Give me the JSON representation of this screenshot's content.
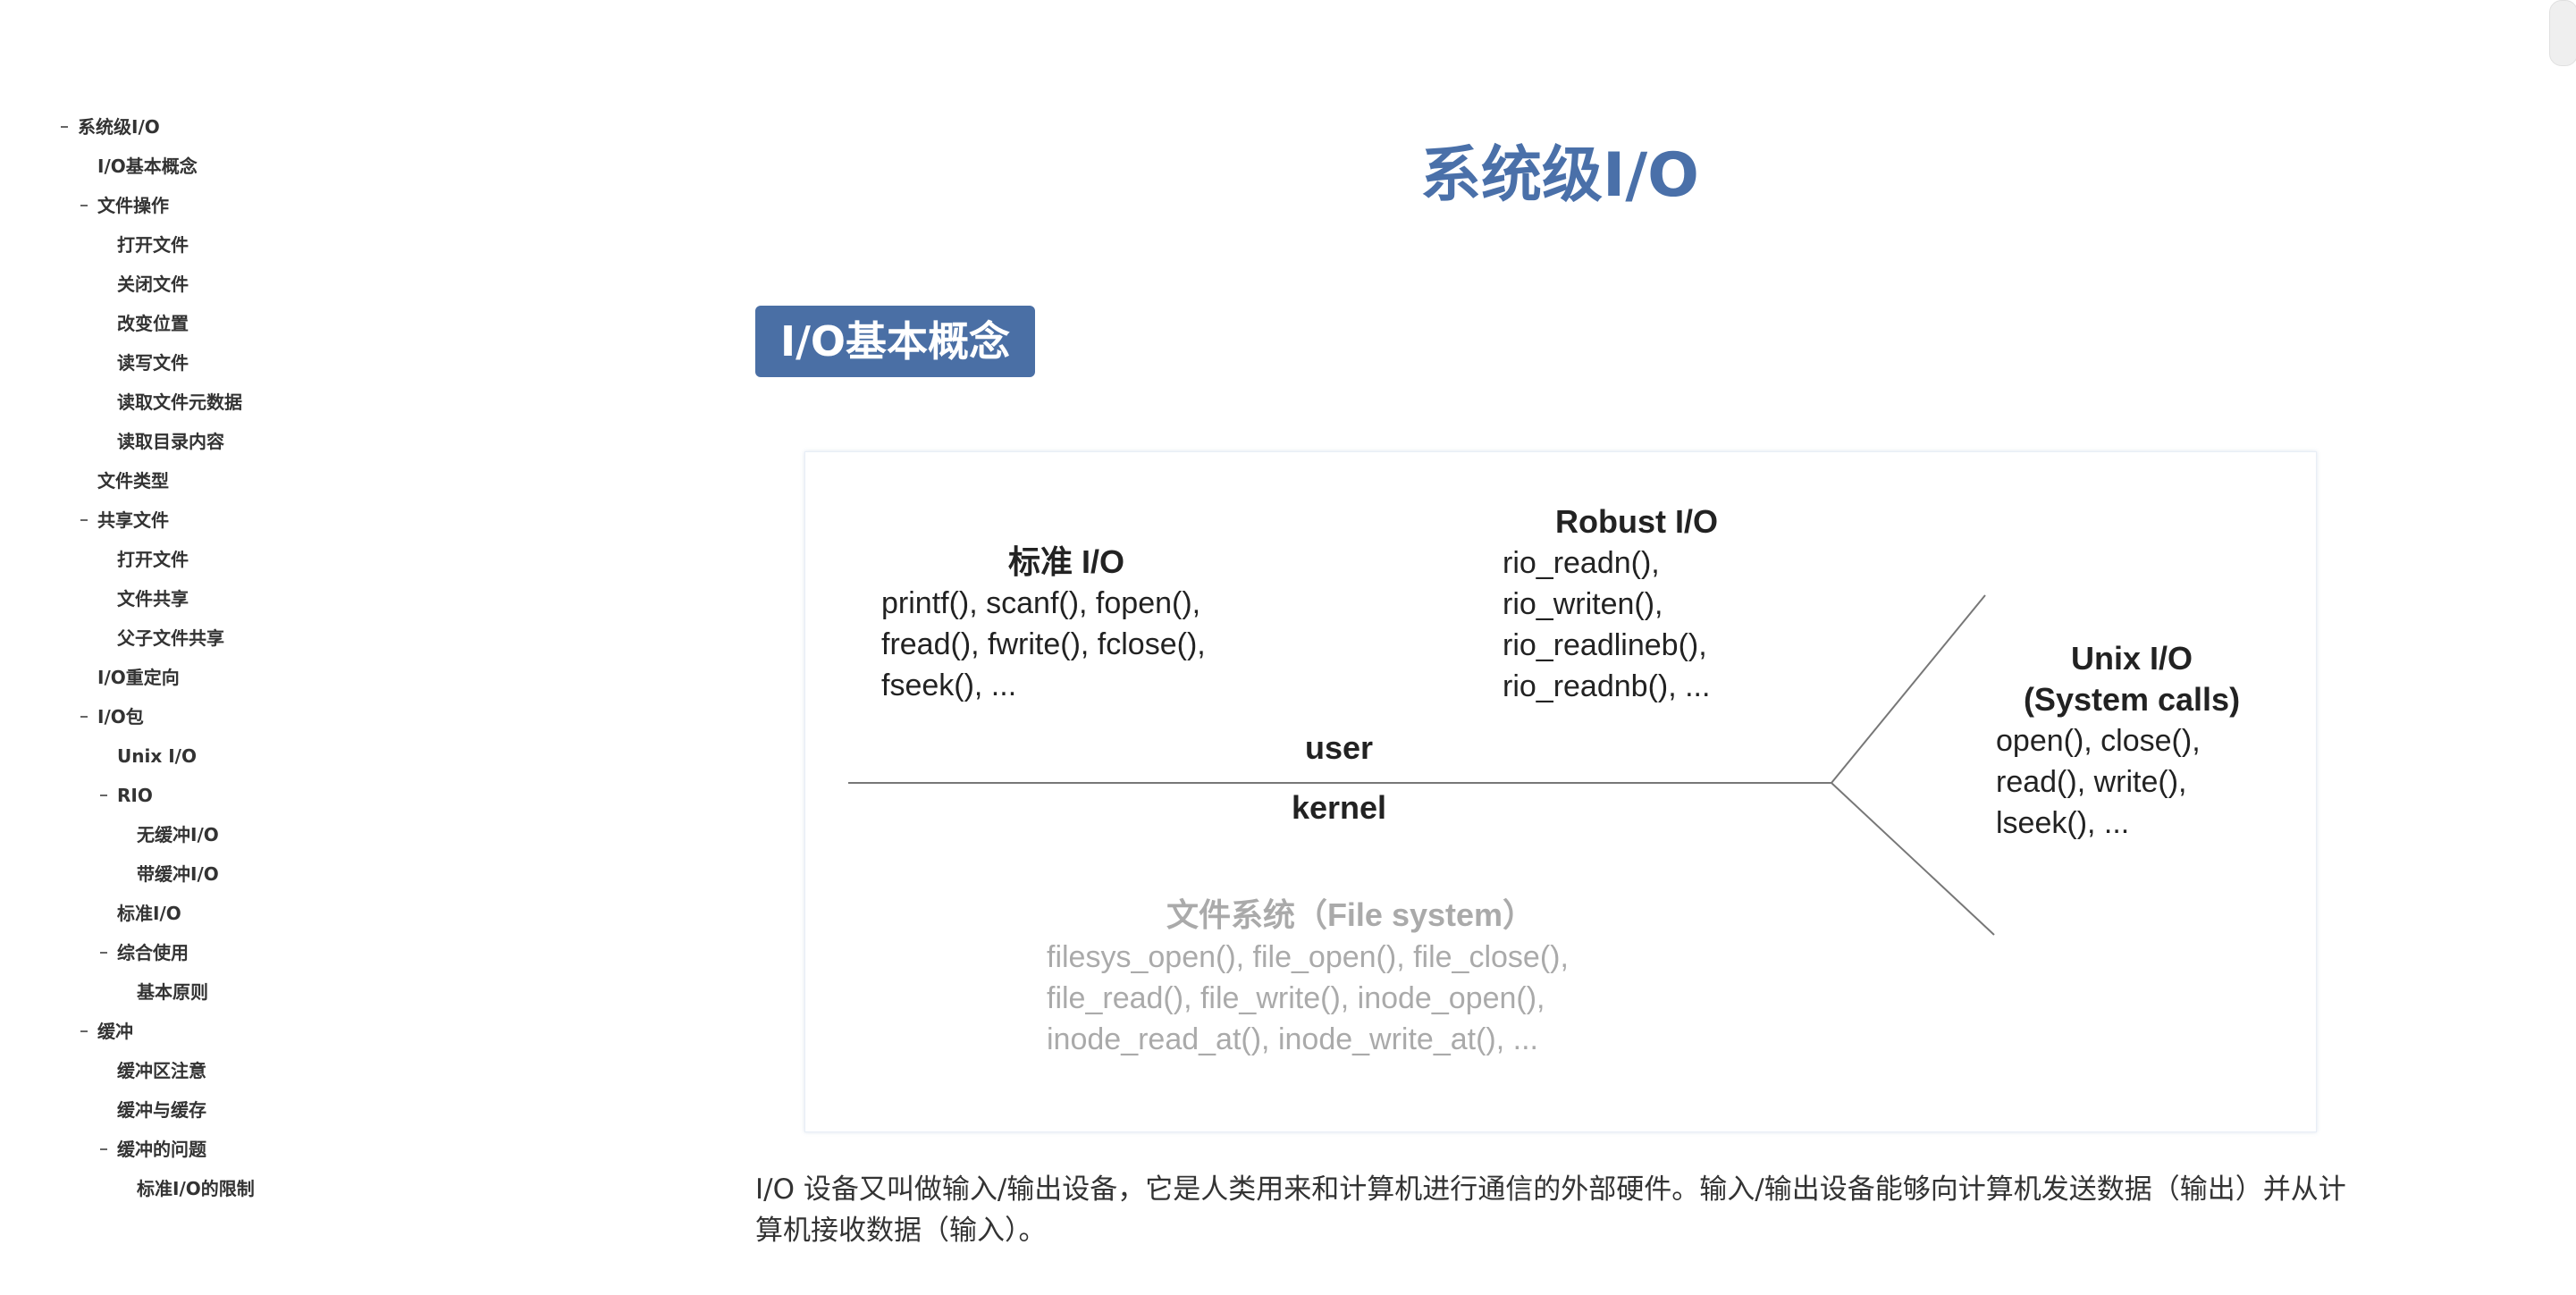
{
  "toc": [
    {
      "label": "系统级I/O",
      "level": 0,
      "collapsible": true
    },
    {
      "label": "I/O基本概念",
      "level": 1,
      "collapsible": false
    },
    {
      "label": "文件操作",
      "level": 1,
      "collapsible": true
    },
    {
      "label": "打开文件",
      "level": 2,
      "collapsible": false
    },
    {
      "label": "关闭文件",
      "level": 2,
      "collapsible": false
    },
    {
      "label": "改变位置",
      "level": 2,
      "collapsible": false
    },
    {
      "label": "读写文件",
      "level": 2,
      "collapsible": false
    },
    {
      "label": "读取文件元数据",
      "level": 2,
      "collapsible": false
    },
    {
      "label": "读取目录内容",
      "level": 2,
      "collapsible": false
    },
    {
      "label": "文件类型",
      "level": 1,
      "collapsible": false
    },
    {
      "label": "共享文件",
      "level": 1,
      "collapsible": true
    },
    {
      "label": "打开文件",
      "level": 2,
      "collapsible": false
    },
    {
      "label": "文件共享",
      "level": 2,
      "collapsible": false
    },
    {
      "label": "父子文件共享",
      "level": 2,
      "collapsible": false
    },
    {
      "label": "I/O重定向",
      "level": 1,
      "collapsible": false
    },
    {
      "label": "I/O包",
      "level": 1,
      "collapsible": true
    },
    {
      "label": "Unix I/O",
      "level": 2,
      "collapsible": false
    },
    {
      "label": "RIO",
      "level": 2,
      "collapsible": true
    },
    {
      "label": "无缓冲I/O",
      "level": 3,
      "collapsible": false
    },
    {
      "label": "带缓冲I/O",
      "level": 3,
      "collapsible": false
    },
    {
      "label": "标准I/O",
      "level": 2,
      "collapsible": false
    },
    {
      "label": "综合使用",
      "level": 2,
      "collapsible": true
    },
    {
      "label": "基本原则",
      "level": 3,
      "collapsible": false
    },
    {
      "label": "缓冲",
      "level": 1,
      "collapsible": true
    },
    {
      "label": "缓冲区注意",
      "level": 2,
      "collapsible": false
    },
    {
      "label": "缓冲与缓存",
      "level": 2,
      "collapsible": false
    },
    {
      "label": "缓冲的问题",
      "level": 2,
      "collapsible": true
    },
    {
      "label": "标准I/O的限制",
      "level": 3,
      "collapsible": false
    }
  ],
  "main": {
    "title": "系统级I/O",
    "section_heading": "I/O基本概念",
    "paragraph": "I/O 设备又叫做输入/输出设备，它是人类用来和计算机进行通信的外部硬件。输入/输出设备能够向计算机发送数据（输出）并从计算机接收数据（输入）。"
  },
  "figure": {
    "standard_io": {
      "title": "标准 I/O",
      "lines": [
        "printf(), scanf(), fopen(),",
        "fread(), fwrite(), fclose(),",
        "fseek(), ..."
      ]
    },
    "robust_io": {
      "title": "Robust I/O",
      "lines": [
        "rio_readn(),",
        "rio_writen(),",
        "rio_readlineb(),",
        "rio_readnb(), ..."
      ]
    },
    "unix_io": {
      "title": "Unix I/O",
      "subtitle": "(System calls)",
      "lines": [
        "open(), close(),",
        "read(), write(),",
        "lseek(), ..."
      ]
    },
    "user_label": "user",
    "kernel_label": "kernel",
    "file_system": {
      "title": "文件系统（File system）",
      "lines": [
        "filesys_open(), file_open(), file_close(),",
        "file_read(), file_write(), inode_open(),",
        "inode_read_at(), inode_write_at(), ..."
      ]
    },
    "colors": {
      "line": "#777777",
      "faded_text": "#aaaaaa"
    }
  },
  "colors": {
    "title": "#4a70a9",
    "badge": "#4a6fa5"
  }
}
